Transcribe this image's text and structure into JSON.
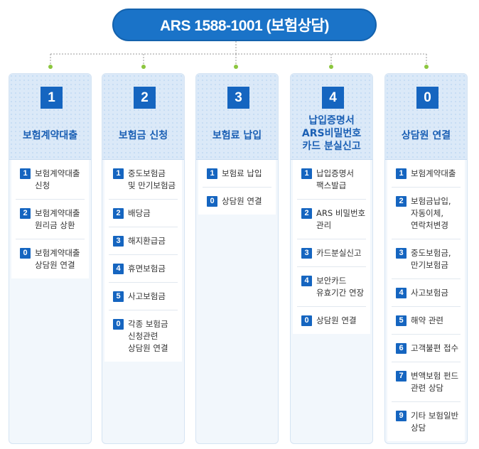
{
  "header": {
    "title": "ARS 1588-1001 (보험상담)"
  },
  "columns": [
    {
      "num": "1",
      "title": "보험계약대출",
      "items": [
        {
          "num": "1",
          "label": "보험계약대출\n신청"
        },
        {
          "num": "2",
          "label": "보험계약대출\n원리금 상환"
        },
        {
          "num": "0",
          "label": "보험계약대출\n상담원 연결"
        }
      ]
    },
    {
      "num": "2",
      "title": "보험금 신청",
      "items": [
        {
          "num": "1",
          "label": "중도보험금\n및 만기보험금"
        },
        {
          "num": "2",
          "label": "배당금"
        },
        {
          "num": "3",
          "label": "해지환급금"
        },
        {
          "num": "4",
          "label": "휴면보험금"
        },
        {
          "num": "5",
          "label": "사고보험금"
        },
        {
          "num": "0",
          "label": "각종 보험금\n신청관련\n상담원 연결"
        }
      ]
    },
    {
      "num": "3",
      "title": "보험료 납입",
      "items": [
        {
          "num": "1",
          "label": "보험료 납입"
        },
        {
          "num": "0",
          "label": "상담원 연결"
        }
      ]
    },
    {
      "num": "4",
      "title": "납입증명서\nARS비밀번호\n카드 분실신고",
      "items": [
        {
          "num": "1",
          "label": "납입증명서\n팩스발급"
        },
        {
          "num": "2",
          "label": "ARS 비밀번호\n관리"
        },
        {
          "num": "3",
          "label": "카드분실신고"
        },
        {
          "num": "4",
          "label": "보안카드\n유효기간 연장"
        },
        {
          "num": "0",
          "label": "상담원 연결"
        }
      ]
    },
    {
      "num": "0",
      "title": "상담원 연결",
      "items": [
        {
          "num": "1",
          "label": "보험계약대출"
        },
        {
          "num": "2",
          "label": "보험금납입,\n자동이체,\n연락처변경"
        },
        {
          "num": "3",
          "label": "중도보험금,\n만기보험금"
        },
        {
          "num": "4",
          "label": "사고보험금"
        },
        {
          "num": "5",
          "label": "해약 관련"
        },
        {
          "num": "6",
          "label": "고객불편 접수"
        },
        {
          "num": "7",
          "label": "변액보험 펀드\n관련 상담"
        },
        {
          "num": "9",
          "label": "기타 보험일반\n상담"
        }
      ]
    }
  ]
}
